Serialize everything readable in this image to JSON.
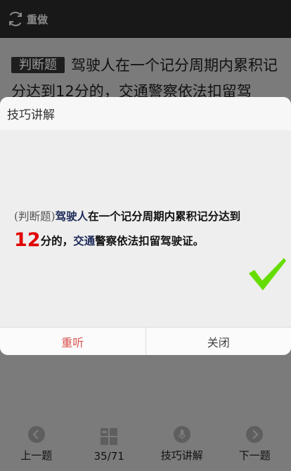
{
  "topbar": {
    "redo_label": "重做",
    "icon": "refresh-icon"
  },
  "question": {
    "tag": "判断题",
    "text": "驾驶人在一个记分周期内累积记分达到12分的，交通警察依法扣留驾"
  },
  "dialog": {
    "title": "技巧讲解",
    "tip": {
      "tag": "(判断题)",
      "keyword1": "驾驶人",
      "part1": "在一个记分周期内累积记分达到",
      "number": "12",
      "part2": "分的，",
      "keyword2": "交通",
      "part3": "警察依法扣留驾驶证。"
    },
    "check_icon": "checkmark-icon",
    "check_color": "#66dd00",
    "buttons": {
      "replay": "重听",
      "close": "关闭"
    }
  },
  "bottom": {
    "prev": "上一题",
    "progress": "35/71",
    "tips": "技巧讲解",
    "next": "下一题"
  },
  "colors": {
    "accent_red": "#e00000",
    "replay_red": "#d9534f"
  }
}
